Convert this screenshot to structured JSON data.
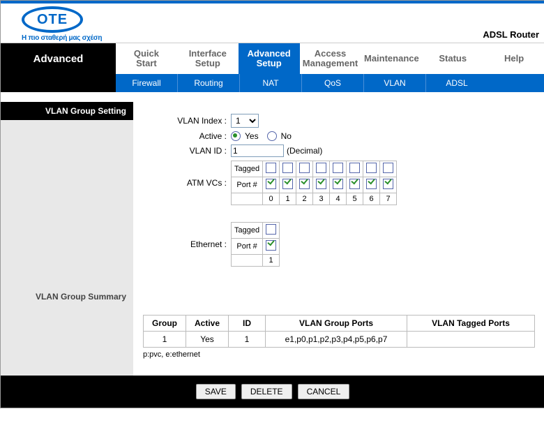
{
  "product": "ADSL Router",
  "logo": {
    "text": "OTE",
    "tagline": "H πιο σταθερή μας σχέση"
  },
  "sidebarTitle": "Advanced",
  "mainTabs": [
    {
      "l1": "Quick",
      "l2": "Start",
      "active": false
    },
    {
      "l1": "Interface",
      "l2": "Setup",
      "active": false
    },
    {
      "l1": "Advanced",
      "l2": "Setup",
      "active": true
    },
    {
      "l1": "Access",
      "l2": "Management",
      "active": false
    },
    {
      "l1": "Maintenance",
      "l2": "",
      "active": false
    },
    {
      "l1": "Status",
      "l2": "",
      "active": false
    },
    {
      "l1": "Help",
      "l2": "",
      "active": false
    }
  ],
  "subTabs": [
    "Firewall",
    "Routing",
    "NAT",
    "QoS",
    "VLAN",
    "ADSL"
  ],
  "sections": {
    "group": "VLAN Group Setting",
    "summary": "VLAN Group Summary"
  },
  "form": {
    "vlanIndex": {
      "label": "VLAN Index :",
      "value": "1"
    },
    "active": {
      "label": "Active :",
      "yes": "Yes",
      "no": "No",
      "value": "yes"
    },
    "vlanId": {
      "label": "VLAN ID :",
      "value": "1",
      "hint": "(Decimal)"
    },
    "atm": {
      "label": "ATM VCs :",
      "taggedLabel": "Tagged",
      "portLabel": "Port #",
      "ports": [
        "0",
        "1",
        "2",
        "3",
        "4",
        "5",
        "6",
        "7"
      ],
      "tagged": [
        false,
        false,
        false,
        false,
        false,
        false,
        false,
        false
      ],
      "member": [
        true,
        true,
        true,
        true,
        true,
        true,
        true,
        true
      ]
    },
    "eth": {
      "label": "Ethernet :",
      "taggedLabel": "Tagged",
      "portLabel": "Port #",
      "ports": [
        "1"
      ],
      "tagged": [
        false
      ],
      "member": [
        true
      ]
    }
  },
  "summary": {
    "headers": {
      "group": "Group",
      "active": "Active",
      "id": "ID",
      "ports": "VLAN Group Ports",
      "tagged": "VLAN Tagged Ports"
    },
    "rows": [
      {
        "group": "1",
        "active": "Yes",
        "id": "1",
        "ports": "e1,p0,p1,p2,p3,p4,p5,p6,p7",
        "tagged": ""
      }
    ],
    "note": "p:pvc, e:ethernet"
  },
  "buttons": {
    "save": "SAVE",
    "delete": "DELETE",
    "cancel": "CANCEL"
  }
}
